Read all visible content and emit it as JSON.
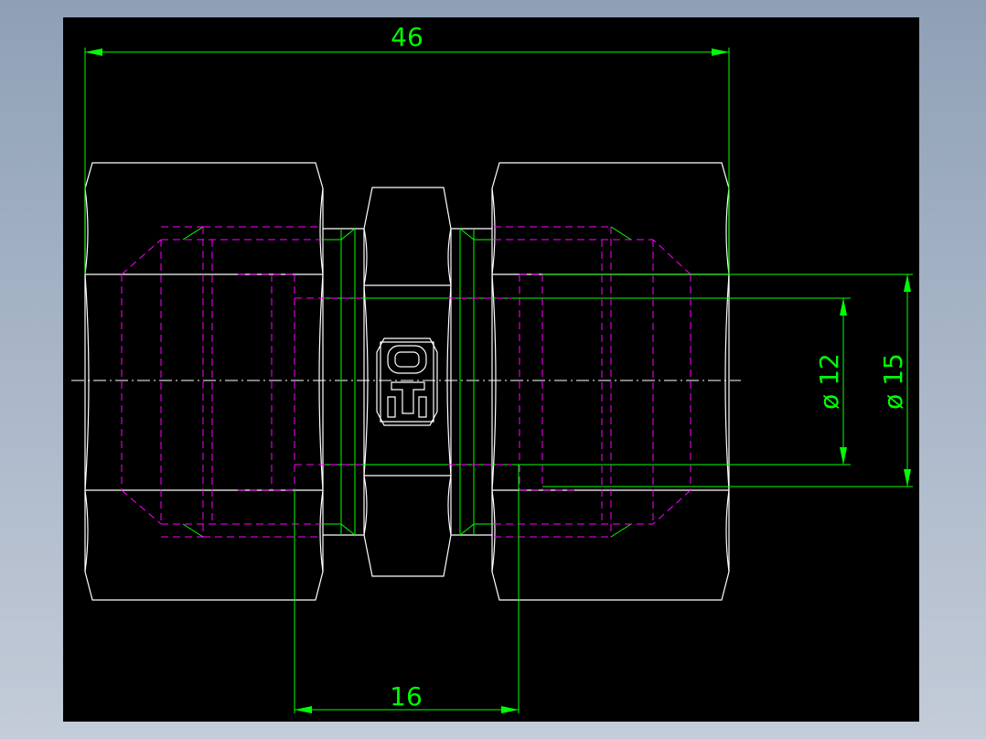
{
  "dimensions": {
    "overall_length": "46",
    "bore_length": "16",
    "inner_diameter": "ø 12",
    "outer_diameter": "ø 15"
  },
  "colors": {
    "background": "#000000",
    "outline": "#ffffff",
    "dimension": "#00ff00",
    "hidden_line": "#ff00ff"
  },
  "icons": {
    "logo": "tsd-logo-icon"
  }
}
